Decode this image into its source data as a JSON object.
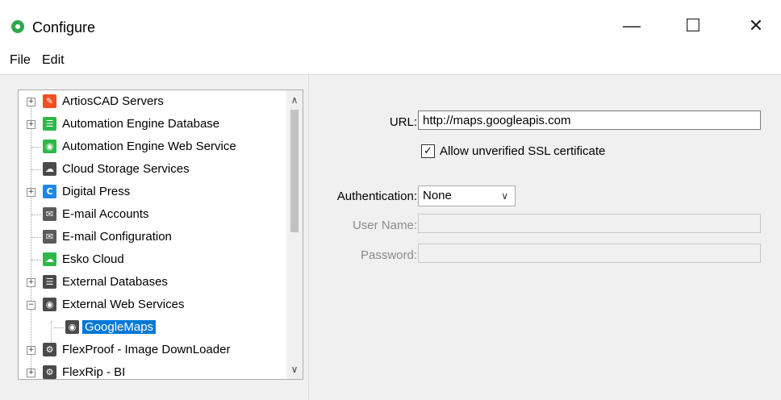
{
  "window": {
    "title": "Configure",
    "minimize_glyph": "—",
    "maximize_glyph": "☐",
    "close_glyph": "✕"
  },
  "menu": {
    "items": [
      "File",
      "Edit"
    ]
  },
  "tree": {
    "items": [
      {
        "label": "ArtiosCAD Servers",
        "icon": "artioscad-icon",
        "color": "#f25022",
        "glyph": "✎",
        "expander": "+",
        "selected": false,
        "child": false
      },
      {
        "label": "Automation Engine Database",
        "icon": "database-icon",
        "color": "#2db84a",
        "glyph": "☰",
        "expander": "+",
        "selected": false,
        "child": false
      },
      {
        "label": "Automation Engine Web Service",
        "icon": "web-service-icon",
        "color": "#2db84a",
        "glyph": "◉",
        "expander": "",
        "selected": false,
        "child": false
      },
      {
        "label": "Cloud Storage Services",
        "icon": "cloud-storage-icon",
        "color": "#4a4a4a",
        "glyph": "☁",
        "expander": "",
        "selected": false,
        "child": false
      },
      {
        "label": "Digital Press",
        "icon": "digital-press-icon",
        "color": "#1e88e5",
        "glyph": "C",
        "expander": "+",
        "selected": false,
        "child": false
      },
      {
        "label": "E-mail Accounts",
        "icon": "email-icon",
        "color": "#5a5a5a",
        "glyph": "✉",
        "expander": "",
        "selected": false,
        "child": false
      },
      {
        "label": "E-mail Configuration",
        "icon": "email-config-icon",
        "color": "#5a5a5a",
        "glyph": "✉",
        "expander": "",
        "selected": false,
        "child": false
      },
      {
        "label": "Esko Cloud",
        "icon": "esko-cloud-icon",
        "color": "#2db84a",
        "glyph": "☁",
        "expander": "",
        "selected": false,
        "child": false
      },
      {
        "label": "External Databases",
        "icon": "external-db-icon",
        "color": "#4a4a4a",
        "glyph": "☰",
        "expander": "+",
        "selected": false,
        "child": false
      },
      {
        "label": "External Web Services",
        "icon": "external-web-icon",
        "color": "#4a4a4a",
        "glyph": "◉",
        "expander": "−",
        "selected": false,
        "child": false
      },
      {
        "label": "GoogleMaps",
        "icon": "google-maps-icon",
        "color": "#4a4a4a",
        "glyph": "◉",
        "expander": "",
        "selected": true,
        "child": true
      },
      {
        "label": "FlexProof - Image DownLoader",
        "icon": "flexproof-icon",
        "color": "#4a4a4a",
        "glyph": "⚙",
        "expander": "+",
        "selected": false,
        "child": false
      },
      {
        "label": "FlexRip - BI",
        "icon": "flexrip-icon",
        "color": "#4a4a4a",
        "glyph": "⚙",
        "expander": "+",
        "selected": false,
        "child": false
      }
    ],
    "scroll_up_glyph": "∧",
    "scroll_down_glyph": "∨"
  },
  "form": {
    "url_label": "URL:",
    "url_value": "http://maps.googleapis.com",
    "ssl_checked_glyph": "✓",
    "ssl_label": "Allow unverified SSL certificate",
    "auth_label": "Authentication:",
    "auth_value": "None",
    "auth_chevron": "∨",
    "username_label": "User Name:",
    "username_value": "",
    "password_label": "Password:",
    "password_value": ""
  },
  "colors": {
    "selection": "#0078d7"
  }
}
